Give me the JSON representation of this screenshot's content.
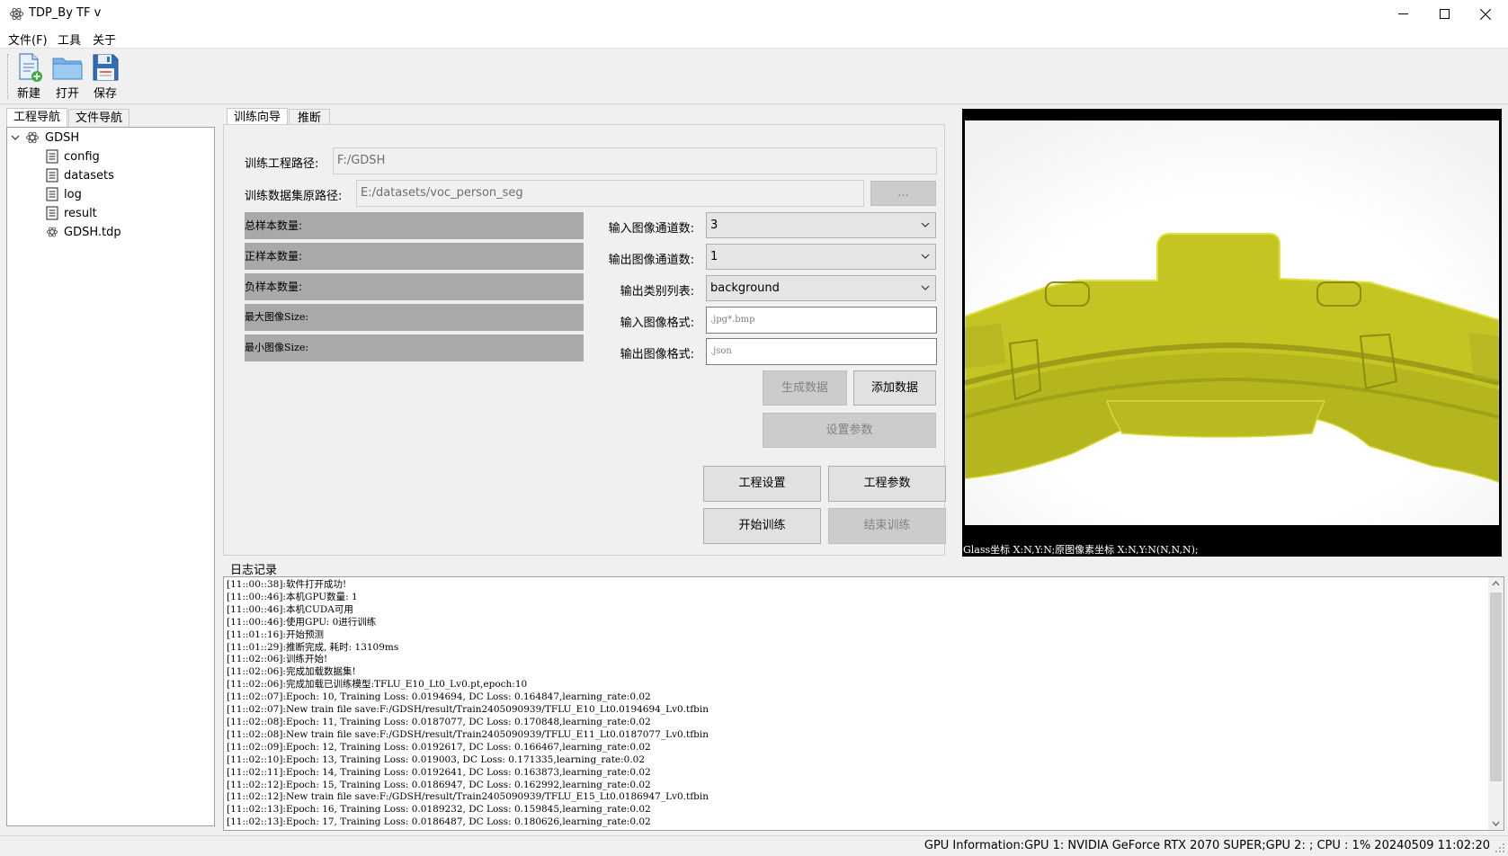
{
  "window": {
    "title": "TDP_By TF v",
    "minimize_icon": "minimize-icon",
    "maximize_icon": "maximize-icon",
    "close_icon": "close-icon"
  },
  "menu": [
    "文件(F)",
    "工具",
    "关于"
  ],
  "toolbar": {
    "new": "新建",
    "open": "打开",
    "save": "保存"
  },
  "left_tabs": [
    "工程导航",
    "文件导航"
  ],
  "tree": {
    "root": "GDSH",
    "children": [
      "config",
      "datasets",
      "log",
      "result",
      "GDSH.tdp"
    ]
  },
  "main_tabs": [
    "训练向导",
    "推断"
  ],
  "form": {
    "project_path_label": "训练工程路径:",
    "project_path_value": "F:/GDSH",
    "dataset_path_label": "训练数据集原路径:",
    "dataset_path_value": "E:/datasets/voc_person_seg",
    "browse_button": "...",
    "total_samples": "总样本数量:",
    "positive_samples": "正样本数量:",
    "negative_samples": "负样本数量:",
    "max_image_size": "最大图像Size:",
    "min_image_size": "最小图像Size:",
    "input_channels_label": "输入图像通道数:",
    "input_channels_value": "3",
    "output_channels_label": "输出图像通道数:",
    "output_channels_value": "1",
    "output_classes_label": "输出类别列表:",
    "output_classes_value": "background",
    "input_format_label": "输入图像格式:",
    "input_format_value": ".jpg*.bmp",
    "output_format_label": "输出图像格式:",
    "output_format_value": ".json"
  },
  "buttons": {
    "generate_data": "生成数据",
    "add_data": "添加数据",
    "set_params": "设置参数",
    "project_settings": "工程设置",
    "project_params": "工程参数",
    "start_training": "开始训练",
    "stop_training": "结束训练"
  },
  "image_panel": {
    "coords_text": "Glass坐标 X:N,Y:N;原图像素坐标 X:N,Y:N(N,N,N);",
    "overlay_color": "#c8c820"
  },
  "log": {
    "title": "日志记录",
    "lines": [
      "[11::00::38]:软件打开成功!",
      "[11::00::46]:本机GPU数量: 1",
      "[11::00::46]:本机CUDA可用",
      "[11::00::46]:使用GPU: 0进行训练",
      "[11::01::16]:开始预测",
      "[11::01::29]:推断完成, 耗时: 13109ms",
      "[11::02::06]:训练开始!",
      "[11::02::06]:完成加载数据集!",
      "[11::02::06]:完成加载已训练模型:TFLU_E10_Lt0_Lv0.pt,epoch:10",
      "[11::02::07]:Epoch: 10, Training Loss: 0.0194694, DC Loss: 0.164847,learning_rate:0.02",
      "[11::02::07]:New train file save:F:/GDSH/result/Train2405090939/TFLU_E10_Lt0.0194694_Lv0.tfbin",
      "[11::02::08]:Epoch: 11, Training Loss: 0.0187077, DC Loss: 0.170848,learning_rate:0.02",
      "[11::02::08]:New train file save:F:/GDSH/result/Train2405090939/TFLU_E11_Lt0.0187077_Lv0.tfbin",
      "[11::02::09]:Epoch: 12, Training Loss: 0.0192617, DC Loss: 0.166467,learning_rate:0.02",
      "[11::02::10]:Epoch: 13, Training Loss: 0.019003, DC Loss: 0.171335,learning_rate:0.02",
      "[11::02::11]:Epoch: 14, Training Loss: 0.0192641, DC Loss: 0.163873,learning_rate:0.02",
      "[11::02::12]:Epoch: 15, Training Loss: 0.0186947, DC Loss: 0.162992,learning_rate:0.02",
      "[11::02::12]:New train file save:F:/GDSH/result/Train2405090939/TFLU_E15_Lt0.0186947_Lv0.tfbin",
      "[11::02::13]:Epoch: 16, Training Loss: 0.0189232, DC Loss: 0.159845,learning_rate:0.02",
      "[11::02::13]:Epoch: 17, Training Loss: 0.0186487, DC Loss: 0.180626,learning_rate:0.02"
    ]
  },
  "status": "GPU Information:GPU 1: NVIDIA GeForce RTX 2070 SUPER;GPU 2: ; CPU : 1% 20240509 11:02:20"
}
